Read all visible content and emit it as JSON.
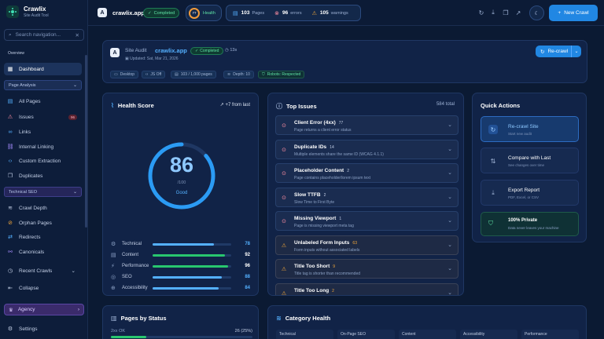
{
  "app": {
    "name": "Crawlix",
    "subtitle": "Site Audit Tool"
  },
  "sidebar": {
    "search_placeholder": "Search navigation...",
    "section_overview": "Overview",
    "dashboard": "Dashboard",
    "section_page_analysis": "Page Analysis",
    "page_items": [
      {
        "label": "All Pages"
      },
      {
        "label": "Issues",
        "badge": "96"
      },
      {
        "label": "Links"
      },
      {
        "label": "Internal Linking"
      },
      {
        "label": "Custom Extraction"
      },
      {
        "label": "Duplicates"
      }
    ],
    "section_technical": "Technical SEO",
    "tech_items": [
      {
        "label": "Crawl Depth"
      },
      {
        "label": "Orphan Pages"
      },
      {
        "label": "Redirects"
      },
      {
        "label": "Canonicals"
      }
    ],
    "recent_crawls": "Recent Crawls",
    "collapse": "Collapse",
    "agency": "Agency",
    "settings": "Settings"
  },
  "topbar": {
    "site": "crawlix.app",
    "status": "Completed",
    "health_score": "77",
    "health_label": "Health",
    "pages_count": "103",
    "pages_label": "Pages",
    "errors_count": "96",
    "errors_label": "errors",
    "warnings_count": "105",
    "warnings_label": "warnings",
    "new_crawl": "New Crawl"
  },
  "audit": {
    "label": "Site Audit",
    "site": "crawlix.app",
    "status": "Completed",
    "duration": "13s",
    "updated": "Updated: Sat, Mar 21, 2026",
    "tags": [
      "Desktop",
      "JS Off",
      "103 / 1,000 pages",
      "Depth: 10",
      "Robots: Respected"
    ],
    "recrawl": "Re-crawl"
  },
  "health": {
    "title": "Health Score",
    "trend": "+7 from last",
    "score": 86,
    "score_text": "86",
    "max": "/100",
    "grade": "Good",
    "metrics": [
      {
        "name": "Technical",
        "value": 78,
        "value_text": "78",
        "color": "#54b0ff"
      },
      {
        "name": "Content",
        "value": 92,
        "value_text": "92",
        "color": "#28c76f"
      },
      {
        "name": "Performance",
        "value": 96,
        "value_text": "96",
        "color": "#28c76f"
      },
      {
        "name": "SEO",
        "value": 88,
        "value_text": "88",
        "color": "#54b0ff"
      },
      {
        "name": "Accessibility",
        "value": 84,
        "value_text": "84",
        "color": "#54b0ff"
      }
    ]
  },
  "issues": {
    "title": "Top Issues",
    "total": "584 total",
    "items": [
      {
        "title": "Client Error (4xx)",
        "count": "77",
        "desc": "Page returns a client error status",
        "severity": "error"
      },
      {
        "title": "Duplicate IDs",
        "count": "14",
        "desc": "Multiple elements share the same ID (WCAG 4.1.1)",
        "severity": "error"
      },
      {
        "title": "Placeholder Content",
        "count": "2",
        "desc": "Page contains placeholder/lorem ipsum text",
        "severity": "error"
      },
      {
        "title": "Slow TTFB",
        "count": "2",
        "desc": "Slow Time to First Byte",
        "severity": "error"
      },
      {
        "title": "Missing Viewport",
        "count": "1",
        "desc": "Page is missing viewport meta tag",
        "severity": "error"
      },
      {
        "title": "Unlabeled Form Inputs",
        "count": "63",
        "desc": "Form inputs without associated labels",
        "severity": "warning"
      },
      {
        "title": "Title Too Short",
        "count": "9",
        "desc": "Title tag is shorter than recommended",
        "severity": "warning"
      },
      {
        "title": "Title Too Long",
        "count": "2",
        "desc": "",
        "severity": "warning"
      }
    ]
  },
  "quick": {
    "title": "Quick Actions",
    "actions": [
      {
        "title": "Re-crawl Site",
        "sub": "Start new audit"
      },
      {
        "title": "Compare with Last",
        "sub": "See changes over time"
      },
      {
        "title": "Export Report",
        "sub": "PDF, Excel, or CSV"
      }
    ],
    "private_title": "100% Private",
    "private_sub": "Data never leaves your machine"
  },
  "status_panel": {
    "title": "Pages by Status",
    "row_label": "2xx OK",
    "row_value": "26 (25%)",
    "fraction": 0.25
  },
  "category": {
    "title": "Category Health",
    "cols": [
      "Technical",
      "On-Page SEO",
      "Content",
      "Accessibility",
      "Performance"
    ]
  },
  "colors": {
    "accent": "#2187e3",
    "success": "#28c76f",
    "error": "#ff8fa3",
    "warning": "#f2a73a"
  }
}
